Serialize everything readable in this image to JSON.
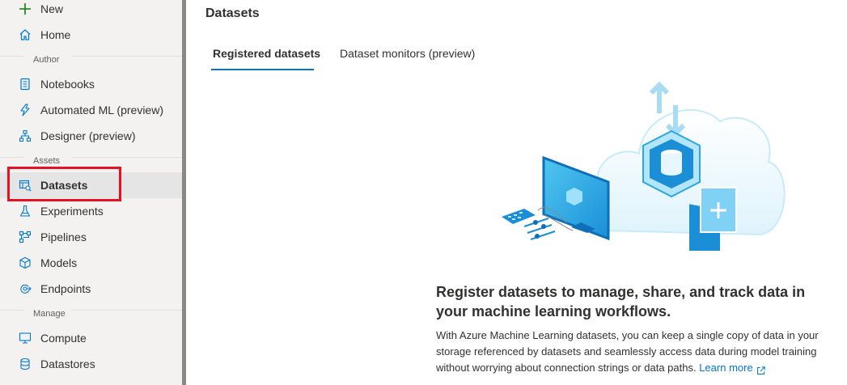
{
  "sidebar": {
    "new_label": "New",
    "home_label": "Home",
    "section_author": "Author",
    "notebooks_label": "Notebooks",
    "automl_label": "Automated ML (preview)",
    "designer_label": "Designer (preview)",
    "section_assets": "Assets",
    "datasets_label": "Datasets",
    "experiments_label": "Experiments",
    "pipelines_label": "Pipelines",
    "models_label": "Models",
    "endpoints_label": "Endpoints",
    "section_manage": "Manage",
    "compute_label": "Compute",
    "datastores_label": "Datastores"
  },
  "main": {
    "title": "Datasets",
    "tabs": [
      {
        "label": "Registered datasets",
        "active": true
      },
      {
        "label": "Dataset monitors (preview)",
        "active": false
      }
    ],
    "empty_state": {
      "title": "Register datasets to manage, share, and track data in your machine learning workflows.",
      "description": "With Azure Machine Learning datasets, you can keep a single copy of data in your storage referenced by datasets and seamlessly access data during model training without worrying about connection strings or data paths.",
      "learn_more": "Learn more"
    }
  },
  "colors": {
    "accent": "#0078d4",
    "highlight": "#e81123",
    "new_icon": "#107c10",
    "sidebar_bg": "#f3f2f1"
  }
}
